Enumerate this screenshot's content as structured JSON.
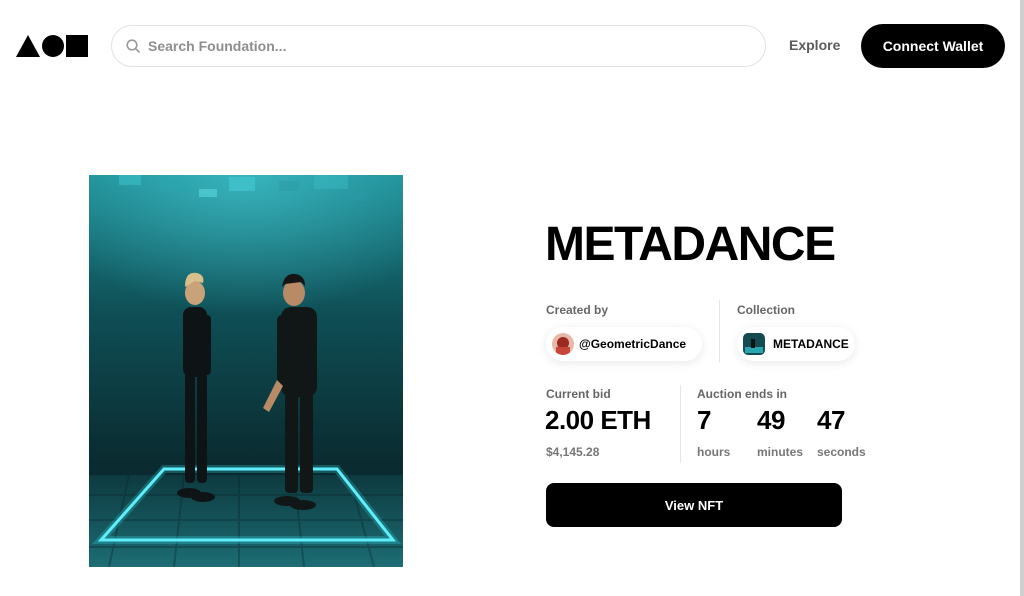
{
  "header": {
    "logo_icon": "foundation-logo-icon",
    "search": {
      "placeholder": "Search Foundation...",
      "value": ""
    },
    "explore_label": "Explore",
    "connect_label": "Connect Wallet"
  },
  "artwork": {
    "icon": "artwork-image"
  },
  "nft": {
    "title": "METADANCE",
    "created_by_label": "Created by",
    "creator": "@GeometricDance",
    "collection_label": "Collection",
    "collection": "METADANCE",
    "current_bid_label": "Current bid",
    "current_bid": "2.00 ETH",
    "current_bid_usd": "$4,145.28",
    "auction_label": "Auction ends in",
    "countdown": {
      "hours": "7",
      "hours_label": "hours",
      "minutes": "49",
      "minutes_label": "minutes",
      "seconds": "47",
      "seconds_label": "seconds"
    },
    "view_label": "View NFT"
  },
  "colors": {
    "primary": "#000000",
    "artwork_teal": "#1a7f86",
    "artwork_glow": "#35e0f0",
    "muted_text": "#666666"
  }
}
